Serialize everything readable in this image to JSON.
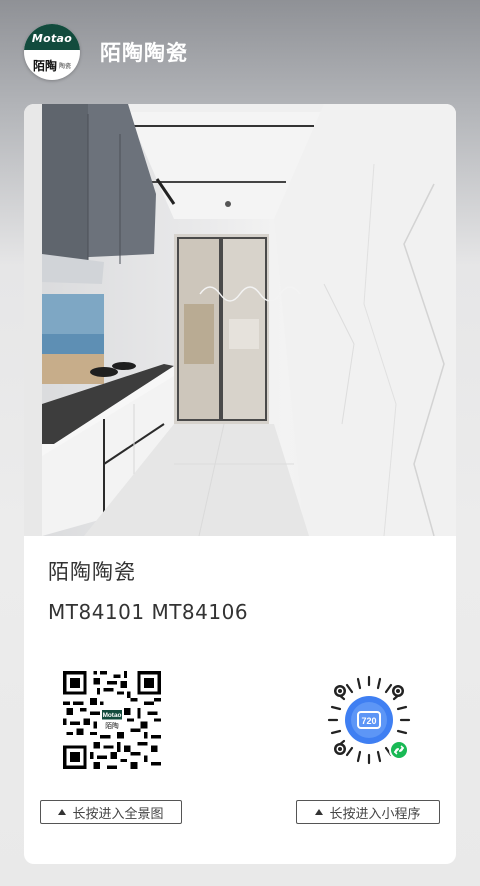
{
  "header": {
    "logo_top": "Motao",
    "logo_cn": "陌陶",
    "logo_sub": "陶瓷",
    "brand_name": "陌陶陶瓷"
  },
  "card": {
    "title": "陌陶陶瓷",
    "models": "MT84101 MT84106",
    "panorama_label": "长按进入全景图",
    "miniprogram_label": "长按进入小程序",
    "miniprogram_badge": "720"
  },
  "colors": {
    "brand_green": "#124b3d",
    "miniprogram_blue": "#3f7ff2",
    "wechat_green": "#19b955"
  }
}
